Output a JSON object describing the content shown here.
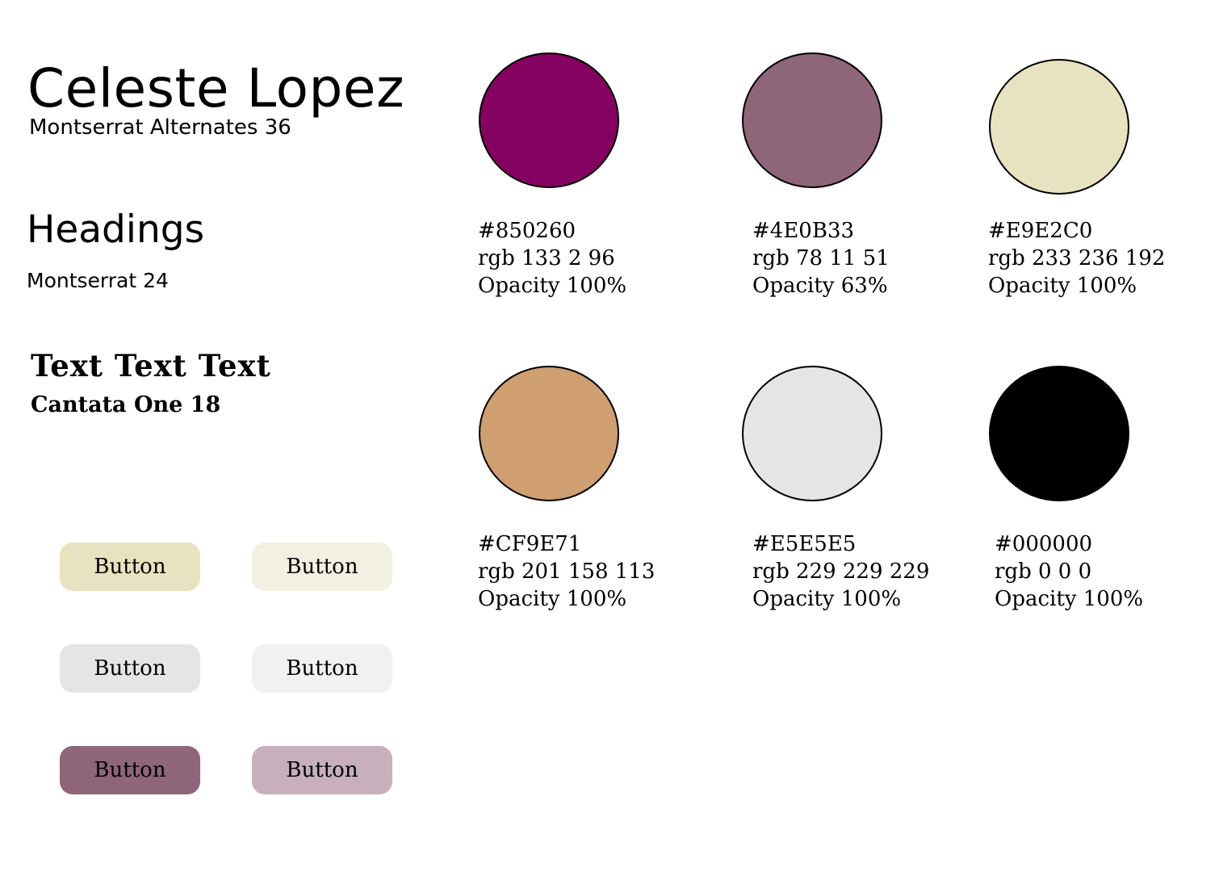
{
  "typography": {
    "name": {
      "text": "Celeste Lopez",
      "spec": "Montserrat Alternates 36"
    },
    "headings": {
      "text": "Headings",
      "spec": "Montserrat 24"
    },
    "body": {
      "text": "Text Text Text",
      "spec": "Cantata One 18"
    }
  },
  "palette": [
    {
      "name": "swatch-850260",
      "color": "#850260",
      "hex": "#850260",
      "rgb": "rgb 133 2 96",
      "opacity": "Opacity 100%"
    },
    {
      "name": "swatch-4e0b33",
      "color": "#8f657a",
      "hex": "#4E0B33",
      "rgb": "rgb 78 11 51",
      "opacity": "Opacity 63%"
    },
    {
      "name": "swatch-e9e2c0",
      "color": "#e7e2c0",
      "hex": "#E9E2C0",
      "rgb": "rgb 233 236 192",
      "opacity": "Opacity 100%"
    },
    {
      "name": "swatch-cf9e71",
      "color": "#cf9e71",
      "hex": "#CF9E71",
      "rgb": "rgb 201 158 113",
      "opacity": "Opacity 100%"
    },
    {
      "name": "swatch-e5e5e5",
      "color": "#e5e5e5",
      "hex": "#E5E5E5",
      "rgb": "rgb 229 229 229",
      "opacity": "Opacity 100%"
    },
    {
      "name": "swatch-000000",
      "color": "#000000",
      "hex": "#000000",
      "rgb": "rgb 0 0 0",
      "opacity": "Opacity 100%"
    }
  ],
  "buttons": [
    {
      "label": "Button",
      "color": "#e8e2c0"
    },
    {
      "label": "Button",
      "color": "#f2f0e0"
    },
    {
      "label": "Button",
      "color": "#e5e5e5"
    },
    {
      "label": "Button",
      "color": "#f1f1f1"
    },
    {
      "label": "Button",
      "color": "#8f657a"
    },
    {
      "label": "Button",
      "color": "#c7b0bc"
    }
  ]
}
